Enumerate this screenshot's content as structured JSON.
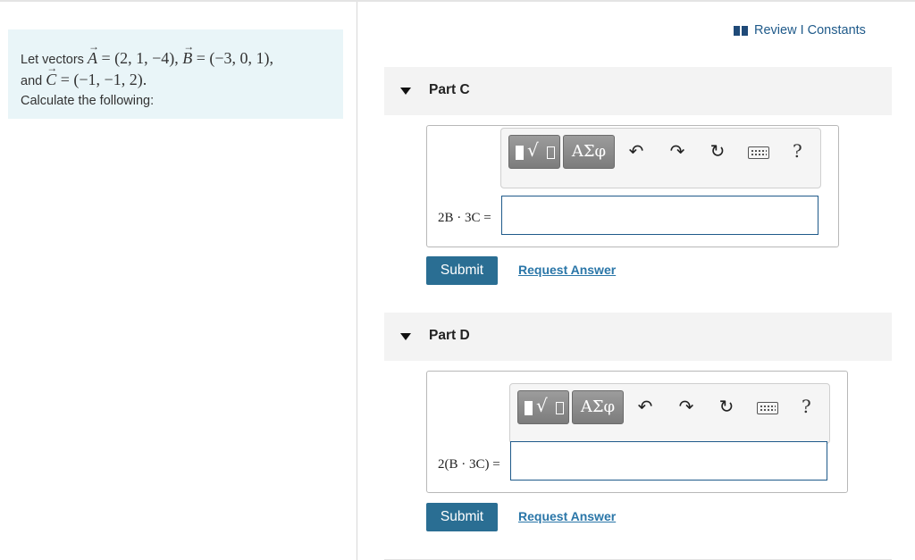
{
  "problem": {
    "lead": "Let vectors",
    "A": "(2, 1, −4)",
    "B": "(−3, 0, 1)",
    "and": "and",
    "C": "(−1, −1, 2)",
    "instruction": "Calculate the following:"
  },
  "header": {
    "review_label": "Review I Constants",
    "review_icon": "book-icon"
  },
  "parts": [
    {
      "label": "Part C",
      "equation": "2B · 3C =",
      "answer_value": "",
      "submit_label": "Submit",
      "request_label": "Request Answer"
    },
    {
      "label": "Part D",
      "equation": "2(B · 3C) =",
      "answer_value": "",
      "submit_label": "Submit",
      "request_label": "Request Answer"
    }
  ],
  "toolbar": {
    "greek_label": "ΑΣφ",
    "help_label": "?",
    "icons": [
      "templates-icon",
      "greek-letters-icon",
      "undo-icon",
      "redo-icon",
      "reset-icon",
      "keyboard-icon",
      "help-icon"
    ]
  },
  "colors": {
    "accent": "#2a6e93",
    "link": "#2a76a8",
    "problem_bg": "#e9f5f8",
    "header_bg": "#f3f3f3"
  }
}
